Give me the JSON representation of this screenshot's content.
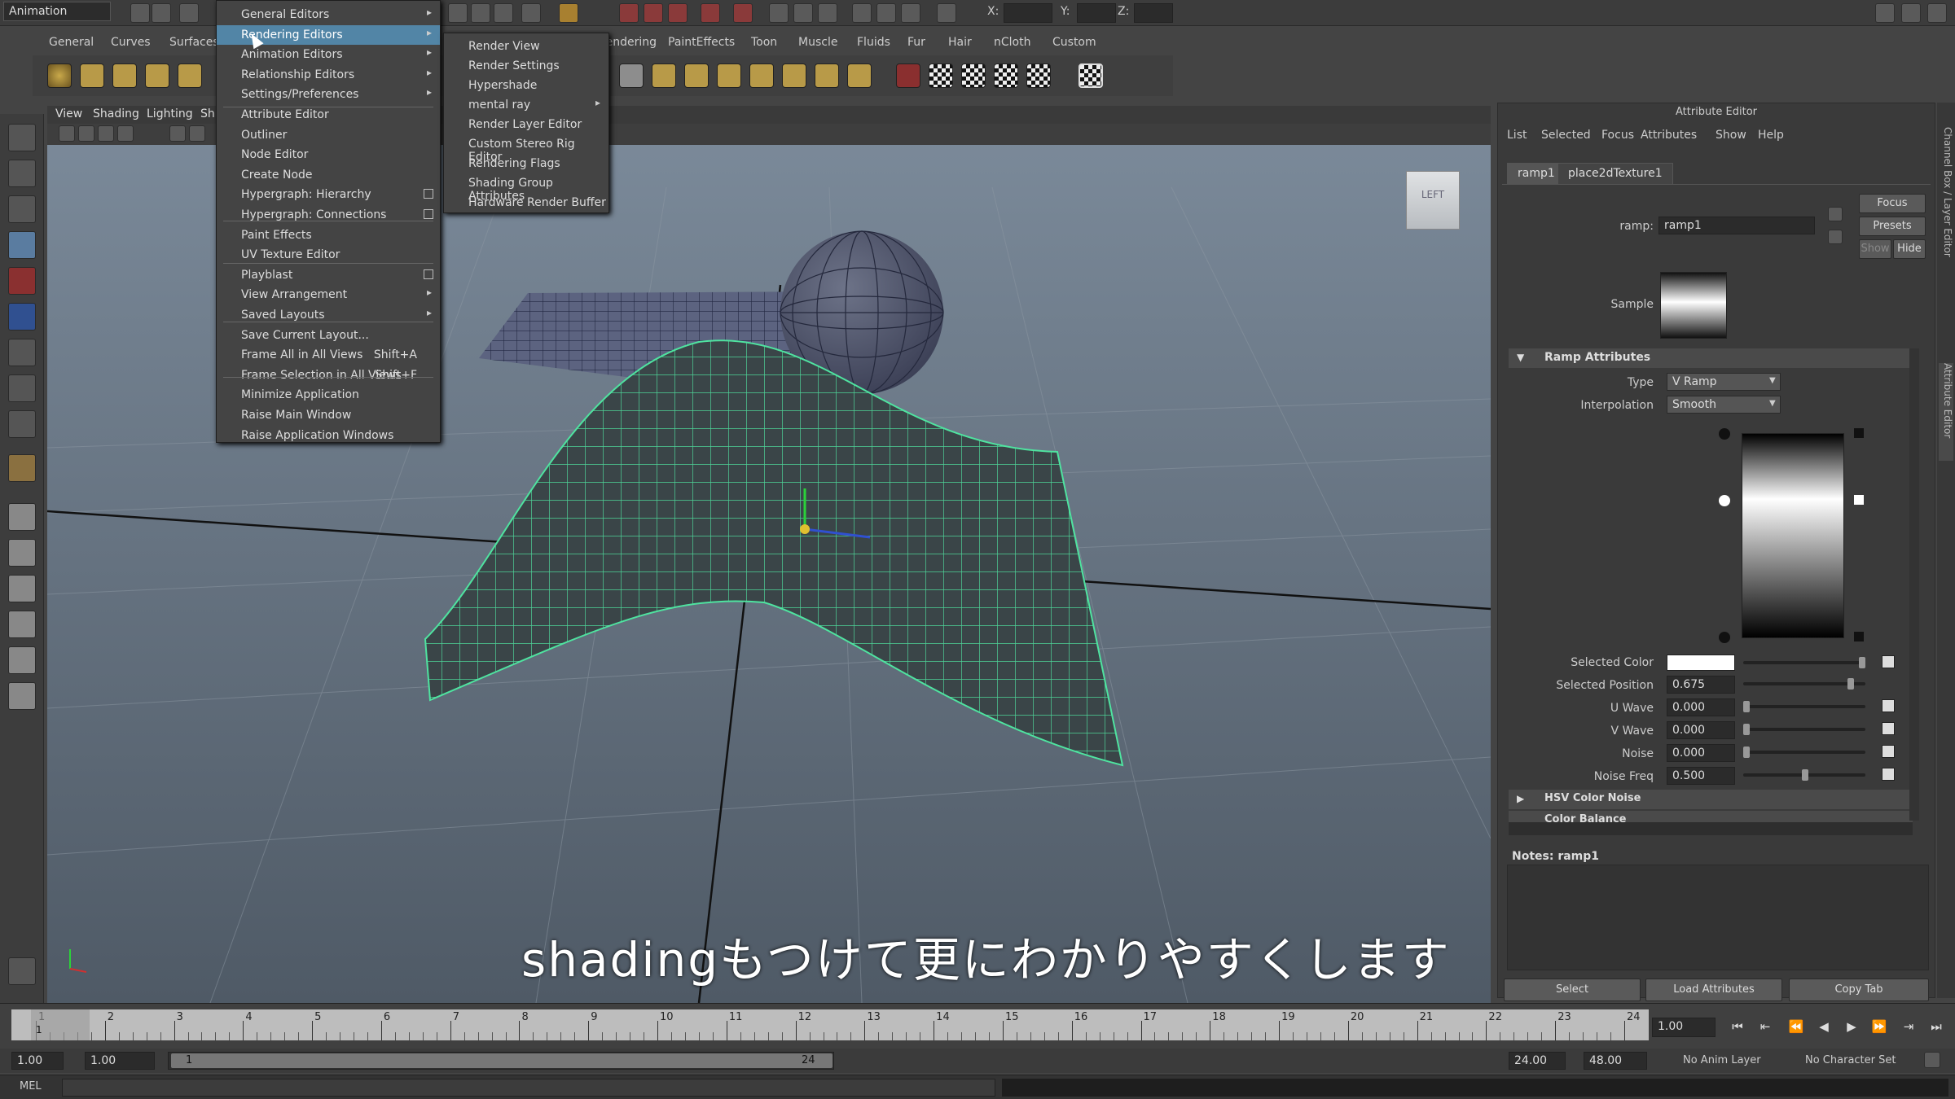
{
  "topbar": {
    "mode": "Animation",
    "coords": [
      "X:",
      "Y:",
      "Z:"
    ]
  },
  "shelf_tabs": [
    "General",
    "Curves",
    "Surfaces",
    "Rendering",
    "PaintEffects",
    "Toon",
    "Muscle",
    "Fluids",
    "Fur",
    "Hair",
    "nCloth",
    "Custom"
  ],
  "viewport_menu": [
    "View",
    "Shading",
    "Lighting",
    "Sh"
  ],
  "viewcube_label": "LEFT",
  "subtitle": "shadingもつけて更にわかりやすくします",
  "window_menu": {
    "items": [
      {
        "label": "General Editors",
        "arrow": true
      },
      {
        "label": "Rendering Editors",
        "arrow": true,
        "highlight": true
      },
      {
        "label": "Animation Editors",
        "arrow": true
      },
      {
        "label": "Relationship Editors",
        "arrow": true
      },
      {
        "label": "Settings/Preferences",
        "arrow": true
      },
      {
        "label": "Attribute Editor"
      },
      {
        "label": "Outliner"
      },
      {
        "label": "Node Editor"
      },
      {
        "label": "Create Node"
      },
      {
        "label": "Hypergraph: Hierarchy",
        "box": true
      },
      {
        "label": "Hypergraph: Connections",
        "box": true
      },
      {
        "label": "Paint Effects"
      },
      {
        "label": "UV Texture Editor"
      },
      {
        "label": "Playblast",
        "box": true
      },
      {
        "label": "View Arrangement",
        "arrow": true
      },
      {
        "label": "Saved Layouts",
        "arrow": true
      },
      {
        "label": "Save Current Layout..."
      },
      {
        "label": "Frame All in All Views",
        "shortcut": "Shift+A"
      },
      {
        "label": "Frame Selection in All Views",
        "shortcut": "Shift+F"
      },
      {
        "label": "Minimize Application"
      },
      {
        "label": "Raise Main Window"
      },
      {
        "label": "Raise Application Windows"
      }
    ]
  },
  "rendering_submenu": {
    "items": [
      {
        "label": "Render View"
      },
      {
        "label": "Render Settings"
      },
      {
        "label": "Hypershade"
      },
      {
        "label": "mental ray",
        "arrow": true
      },
      {
        "label": "Render Layer Editor"
      },
      {
        "label": "Custom Stereo Rig Editor"
      },
      {
        "label": "Rendering Flags"
      },
      {
        "label": "Shading Group Attributes"
      },
      {
        "label": "Hardware Render Buffer"
      }
    ]
  },
  "attribute_editor": {
    "title": "Attribute Editor",
    "menu": [
      "List",
      "Selected",
      "Focus",
      "Attributes",
      "Show",
      "Help"
    ],
    "tabs": [
      "ramp1",
      "place2dTexture1"
    ],
    "node_label": "ramp:",
    "node_name": "ramp1",
    "focus_button": "Focus",
    "presets_button": "Presets",
    "show_button": "Show",
    "hide_button": "Hide",
    "sample_label": "Sample",
    "section_ramp": "Ramp Attributes",
    "type_label": "Type",
    "type_value": "V Ramp",
    "interp_label": "Interpolation",
    "interp_value": "Smooth",
    "selected_color_label": "Selected Color",
    "selected_position_label": "Selected Position",
    "selected_position_value": "0.675",
    "uwave_label": "U Wave",
    "uwave_value": "0.000",
    "vwave_label": "V Wave",
    "vwave_value": "0.000",
    "noise_label": "Noise",
    "noise_value": "0.000",
    "noisefreq_label": "Noise Freq",
    "noisefreq_value": "0.500",
    "section_hsv": "HSV Color Noise",
    "section_balance": "Color Balance",
    "notes_label": "Notes: ramp1",
    "bottom_buttons": [
      "Select",
      "Load Attributes",
      "Copy Tab"
    ],
    "side_tabs": [
      "Channel Box / Layer Editor",
      "Attribute Editor"
    ]
  },
  "timeline": {
    "ticks": [
      "1",
      "2",
      "3",
      "4",
      "5",
      "6",
      "7",
      "8",
      "9",
      "10",
      "11",
      "12",
      "13",
      "14",
      "15",
      "16",
      "17",
      "18",
      "19",
      "20",
      "21",
      "22",
      "23",
      "24"
    ],
    "current_frame": "1.00",
    "current_marker": "1"
  },
  "range_bar": {
    "start": "1.00",
    "start2": "1.00",
    "range_start_label": "1",
    "range_end_label": "24",
    "end": "24.00",
    "end2": "48.00",
    "anim_layer": "No Anim Layer",
    "char_set": "No Character Set"
  },
  "command_line": {
    "label": "MEL"
  },
  "colors": {
    "highlight": "#5285a6",
    "wire": "#4fe3a0",
    "sphere": "#5a6072"
  }
}
